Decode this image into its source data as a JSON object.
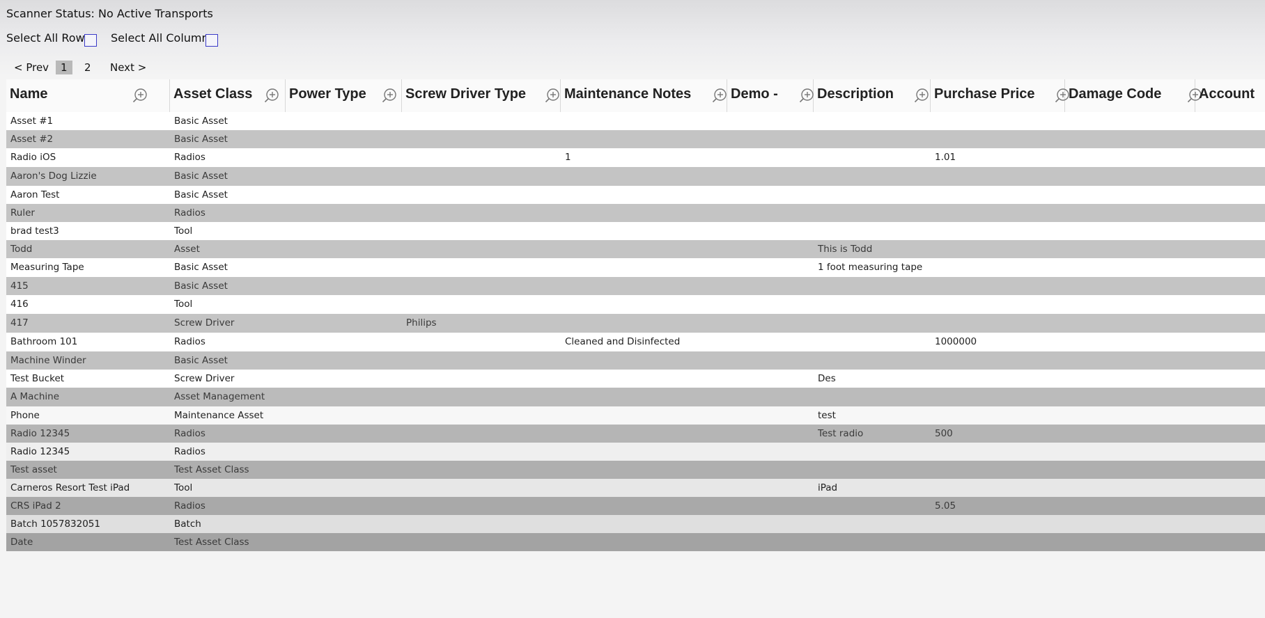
{
  "status": {
    "text": "Scanner Status: No Active Transports"
  },
  "selection": {
    "rows_label": "Select All Rows",
    "columns_label": "Select All Columns"
  },
  "pager": {
    "prev": "< Prev",
    "pages": [
      "1",
      "2"
    ],
    "current": "1",
    "next": "Next >"
  },
  "table": {
    "columns": [
      "Name",
      "Asset Class",
      "Power Type",
      "Screw Driver Type",
      "Maintenance Notes",
      "Demo -",
      "Description",
      "Purchase Price",
      "Damage Code",
      "Account"
    ],
    "rows": [
      [
        "Asset #1",
        "Basic Asset",
        "",
        "",
        "",
        "",
        "",
        "",
        "",
        ""
      ],
      [
        "Asset #2",
        "Basic Asset",
        "",
        "",
        "",
        "",
        "",
        "",
        "",
        ""
      ],
      [
        "Radio iOS",
        "Radios",
        "",
        "",
        "1",
        "",
        "",
        "1.01",
        "",
        ""
      ],
      [
        "Aaron's Dog Lizzie",
        "Basic Asset",
        "",
        "",
        "",
        "",
        "",
        "",
        "",
        ""
      ],
      [
        "Aaron Test",
        "Basic Asset",
        "",
        "",
        "",
        "",
        "",
        "",
        "",
        ""
      ],
      [
        "Ruler",
        "Radios",
        "",
        "",
        "",
        "",
        "",
        "",
        "",
        ""
      ],
      [
        "brad test3",
        "Tool",
        "",
        "",
        "",
        "",
        "",
        "",
        "",
        ""
      ],
      [
        "Todd",
        "Asset",
        "",
        "",
        "",
        "",
        "This is Todd",
        "",
        "",
        ""
      ],
      [
        "Measuring Tape",
        "Basic Asset",
        "",
        "",
        "",
        "",
        "1 foot measuring tape",
        "",
        "",
        ""
      ],
      [
        "415",
        "Basic Asset",
        "",
        "",
        "",
        "",
        "",
        "",
        "",
        ""
      ],
      [
        "416",
        "Tool",
        "",
        "",
        "",
        "",
        "",
        "",
        "",
        ""
      ],
      [
        "417",
        "Screw Driver",
        "",
        "Philips",
        "",
        "",
        "",
        "",
        "",
        ""
      ],
      [
        "Bathroom 101",
        "Radios",
        "",
        "",
        "Cleaned and Disinfected",
        "",
        "",
        "1000000",
        "",
        ""
      ],
      [
        "Machine Winder",
        "Basic Asset",
        "",
        "",
        "",
        "",
        "",
        "",
        "",
        ""
      ],
      [
        "Test Bucket",
        "Screw Driver",
        "",
        "",
        "",
        "",
        "Des",
        "",
        "",
        ""
      ],
      [
        "A Machine",
        "Asset Management",
        "",
        "",
        "",
        "",
        "",
        "",
        "",
        ""
      ],
      [
        "Phone",
        "Maintenance Asset",
        "",
        "",
        "",
        "",
        "test",
        "",
        "",
        ""
      ],
      [
        "Radio 12345",
        "Radios",
        "",
        "",
        "",
        "",
        "Test radio",
        "500",
        "",
        ""
      ],
      [
        "Radio 12345",
        "Radios",
        "",
        "",
        "",
        "",
        "",
        "",
        "",
        ""
      ],
      [
        "Test asset",
        "Test Asset Class",
        "",
        "",
        "",
        "",
        "",
        "",
        "",
        ""
      ],
      [
        "Carneros Resort Test iPad",
        "Tool",
        "",
        "",
        "",
        "",
        "iPad",
        "",
        "",
        ""
      ],
      [
        "CRS iPad 2",
        "Radios",
        "",
        "",
        "",
        "",
        "",
        "5.05",
        "",
        ""
      ],
      [
        "Batch 1057832051",
        "Batch",
        "",
        "",
        "",
        "",
        "",
        "",
        "",
        ""
      ],
      [
        "Date",
        "Test Asset Class",
        "",
        "",
        "",
        "",
        "",
        "",
        "",
        ""
      ]
    ]
  },
  "icons": {
    "column_zoom": "zoom-in-icon",
    "select_box": "checkbox"
  },
  "colors": {
    "checkbox_border": "#3a3ac8",
    "header_bg": "#fafafa",
    "row_light": "#ffffff",
    "row_gray": "#c4c4c4",
    "pager_current_bg": "#b9b9b9"
  }
}
